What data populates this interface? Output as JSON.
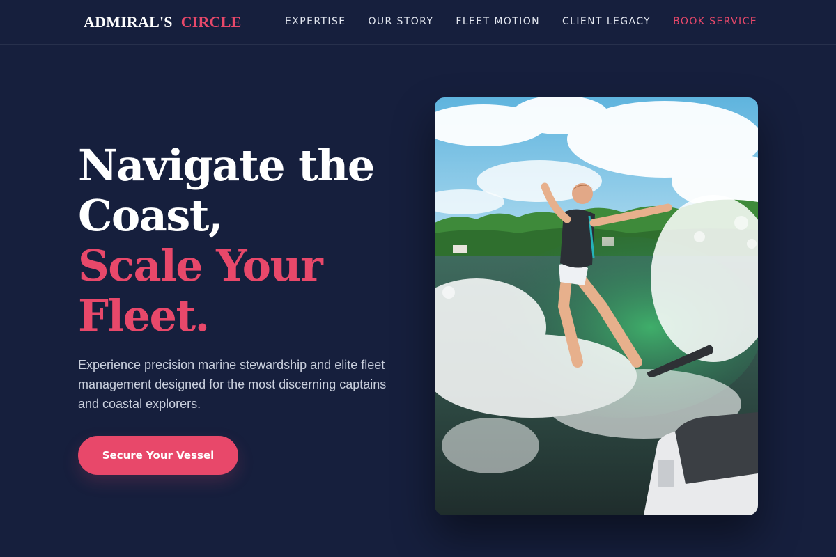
{
  "brand": {
    "name_primary": "ADMIRAL'S",
    "name_accent": "CIRCLE"
  },
  "nav": {
    "items": [
      {
        "label": "EXPERTISE"
      },
      {
        "label": "OUR STORY"
      },
      {
        "label": "FLEET MOTION"
      },
      {
        "label": "CLIENT LEGACY"
      }
    ],
    "cta_label": "BOOK SERVICE"
  },
  "hero": {
    "title_line_1": "Navigate the",
    "title_line_2": "Coast,",
    "title_accent_line_1": "Scale Your",
    "title_accent_line_2": "Fleet.",
    "subtitle": "Experience precision marine stewardship and elite fleet management designed for the most discerning captains and coastal explorers.",
    "cta_label": "Secure Your Vessel"
  },
  "colors": {
    "background": "#161f3d",
    "accent": "#e8486a",
    "text_primary": "#ffffff",
    "text_muted": "#c9cfdd"
  }
}
